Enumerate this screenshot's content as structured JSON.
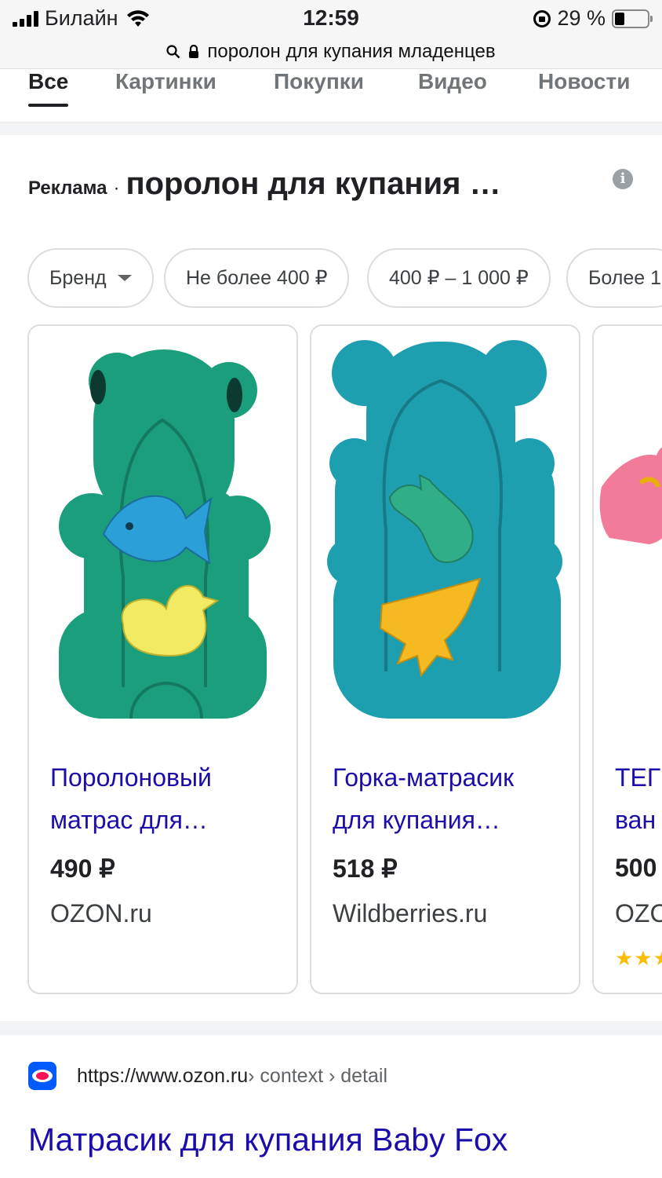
{
  "status_bar": {
    "carrier": "Билайн",
    "time": "12:59",
    "battery": "29 %",
    "battery_level": 0.29
  },
  "url_bar": {
    "url": "поролон для купания младенцев"
  },
  "tabs": [
    {
      "label": "Все",
      "active": true
    },
    {
      "label": "Картинки",
      "active": false
    },
    {
      "label": "Покупки",
      "active": false
    },
    {
      "label": "Видео",
      "active": false
    },
    {
      "label": "Новости",
      "active": false
    }
  ],
  "ad": {
    "label": "Реклама",
    "separator": "·",
    "query": "поролон для купания …",
    "info_icon": "info-icon"
  },
  "chips": [
    {
      "label": "Бренд",
      "has_caret": true
    },
    {
      "label": "Не более 400 ₽"
    },
    {
      "label": "400 ₽ – 1 000 ₽"
    },
    {
      "label": "Более 1"
    }
  ],
  "products": [
    {
      "title_line1": "Поролоновый",
      "title_line2": "матрас для…",
      "price": "490 ₽",
      "store": "OZON.ru",
      "image": "green bear-shaped bath sponge with blue fish and yellow duck"
    },
    {
      "title_line1": "Горка-матрасик",
      "title_line2": "для купания…",
      "price": "518 ₽",
      "store": "Wildberries.ru",
      "image": "teal bear-shaped bath sponge with green giraffe and yellow rocket"
    },
    {
      "title_line1": "ТЕГ",
      "title_line2": "ван",
      "price": "500",
      "store": "OZC",
      "stars": "★★★",
      "image": "pink bath sponge"
    }
  ],
  "result": {
    "url": "https://www.ozon.ru",
    "path": " › context › detail",
    "title": "Матрасик для купания Baby Fox",
    "favicon": "ozon-favicon"
  },
  "colors": {
    "link": "#1a0dab",
    "accent": "#202124",
    "chip_border": "#dadce0"
  }
}
